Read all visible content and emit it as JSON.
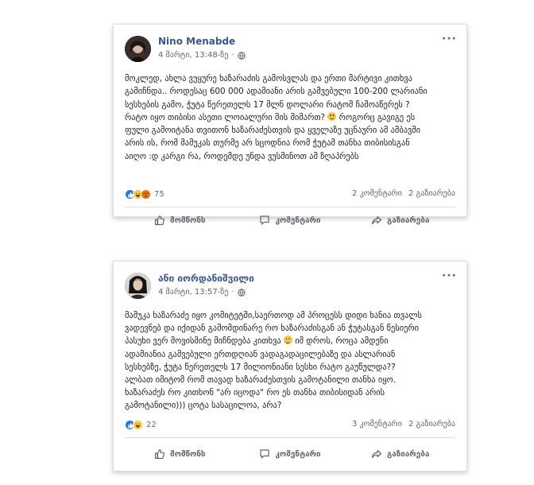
{
  "colors": {
    "author_link": "#385898",
    "meta_gray": "#606770",
    "text": "#1c1e21",
    "like_blue": "#1877f2",
    "haha_yellow": "#f7c948",
    "angry_orange": "#e9710f"
  },
  "posts": [
    {
      "author": "Nino Menabde",
      "timestamp": "4 მარტი, 13:48-ზე",
      "privacy_icon": "globe-icon",
      "more_label": "···",
      "body_lines": [
        "მოკლედ, ახლა ვუყურე ხაზარაძის გამოსვლას და ერთი მარტივი კითხვა",
        "გამიჩნდა.. როდესაც 600 000 ადამიანი არის გამვებული 100-200 ლარიანი",
        "სესხების გამო, ჭუტა წერეთელს 17 მლნ დოლარი რატომ ჩამოაწერეს ?",
        "რატო იყო თიბისი ასეთი ლოიალური მის მიმართ? ",
        "ფული გამოიტანა თვითონ ხაზარაძესთვის და ყველაზე უცნაური ამ ამბავში",
        "არის ის, რომ მამუკას თურმე არ სცოდნია რომ ჭუტამ თანხა თიბისისგან",
        "აიღო :დ კარგი რა, როდემდე უნდა ვუსმინოთ ამ ზღაპრებს"
      ],
      "body_line4_tail": " როგორც გავიგე ეს",
      "reactions": [
        "like",
        "haha",
        "angry"
      ],
      "reaction_count": "75",
      "comments": "2 კომენტარი",
      "shares": "2 გაზიარება"
    },
    {
      "author": "ანი იორდანიშვილი",
      "timestamp": "4 მარტი, 13:57-ზე",
      "privacy_icon": "globe-icon",
      "more_label": "···",
      "body_lines": [
        "მამუკა ხაზარაძე იყო კომიტეტში,საერთოდ ამ პროცესს დიდი ხანია თვალს",
        "ვადევნებ და იქიდან გამომდინარე რო ხაზარაძისგან ან ჭუტასგან წესიერი",
        "პასუხი ვერ მოვისმინე მიჩნდება კითხვა ",
        "ადამიანია გამვებული ერთდღიან ვადაგადაცილებაზე და ასლარიან",
        "სესხებზე, ჭუტა წერეთელს 17 მილიონიანი სესხი რატო გაუწულდა??",
        "ალბათ იმიტომ რომ თავად ხაზარაძესთვის გამოტანილი თანხა იყო.",
        "ხაზარაძეს რო კითხონ \"არ იცოდა\" რო ეს თანხა თიბისიდან არის",
        "გამოტანილი))) ცოტა სასაცილოა, არა?"
      ],
      "body_line3_tail": " იმ დროს, როცა ამდენი",
      "reactions": [
        "like",
        "haha"
      ],
      "reaction_count": "22",
      "comments": "3 კომენტარი",
      "shares": "2 გაზიარება"
    }
  ],
  "actions": {
    "like": "მომწონს",
    "comment": "კომენტარი",
    "share": "გაზიარება"
  }
}
